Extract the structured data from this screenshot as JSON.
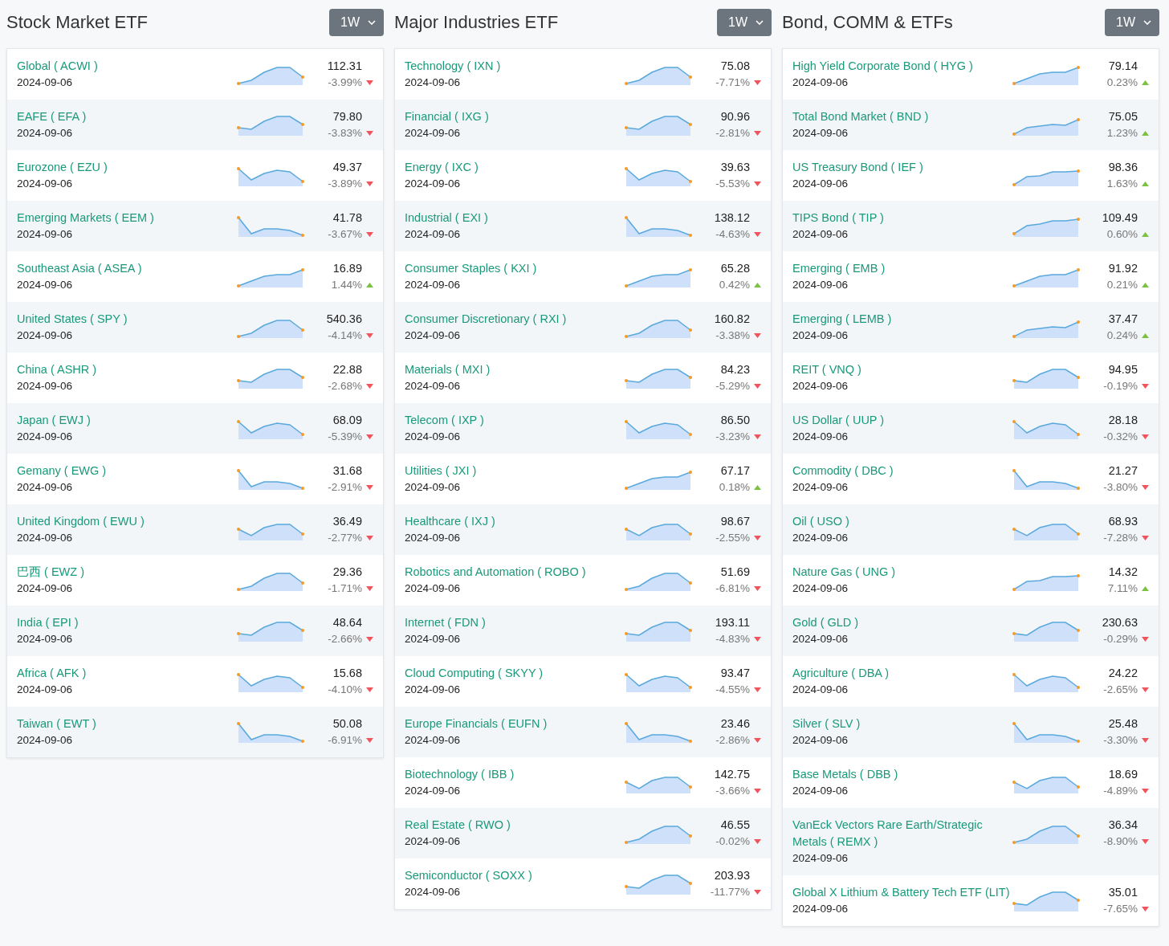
{
  "panels": [
    {
      "title": "Stock Market ETF",
      "period": "1W",
      "rows": [
        {
          "name": "Global ( ACWI )",
          "date": "2024-09-06",
          "price": "112.31",
          "change": "-3.99%",
          "kind": "down"
        },
        {
          "name": "EAFE ( EFA )",
          "date": "2024-09-06",
          "price": "79.80",
          "change": "-3.83%",
          "kind": "down"
        },
        {
          "name": "Eurozone ( EZU )",
          "date": "2024-09-06",
          "price": "49.37",
          "change": "-3.89%",
          "kind": "down"
        },
        {
          "name": "Emerging Markets ( EEM )",
          "date": "2024-09-06",
          "price": "41.78",
          "change": "-3.67%",
          "kind": "down"
        },
        {
          "name": "Southeast Asia ( ASEA )",
          "date": "2024-09-06",
          "price": "16.89",
          "change": "1.44%",
          "kind": "up"
        },
        {
          "name": "United States ( SPY )",
          "date": "2024-09-06",
          "price": "540.36",
          "change": "-4.14%",
          "kind": "down"
        },
        {
          "name": "China ( ASHR )",
          "date": "2024-09-06",
          "price": "22.88",
          "change": "-2.68%",
          "kind": "down"
        },
        {
          "name": "Japan ( EWJ )",
          "date": "2024-09-06",
          "price": "68.09",
          "change": "-5.39%",
          "kind": "down"
        },
        {
          "name": "Gemany ( EWG )",
          "date": "2024-09-06",
          "price": "31.68",
          "change": "-2.91%",
          "kind": "down"
        },
        {
          "name": "United Kingdom ( EWU )",
          "date": "2024-09-06",
          "price": "36.49",
          "change": "-2.77%",
          "kind": "down"
        },
        {
          "name": "巴西 ( EWZ )",
          "date": "2024-09-06",
          "price": "29.36",
          "change": "-1.71%",
          "kind": "down"
        },
        {
          "name": "India ( EPI )",
          "date": "2024-09-06",
          "price": "48.64",
          "change": "-2.66%",
          "kind": "down"
        },
        {
          "name": "Africa ( AFK )",
          "date": "2024-09-06",
          "price": "15.68",
          "change": "-4.10%",
          "kind": "down"
        },
        {
          "name": "Taiwan ( EWT )",
          "date": "2024-09-06",
          "price": "50.08",
          "change": "-6.91%",
          "kind": "down"
        }
      ]
    },
    {
      "title": "Major Industries ETF",
      "period": "1W",
      "rows": [
        {
          "name": "Technology ( IXN )",
          "date": "2024-09-06",
          "price": "75.08",
          "change": "-7.71%",
          "kind": "down"
        },
        {
          "name": "Financial ( IXG )",
          "date": "2024-09-06",
          "price": "90.96",
          "change": "-2.81%",
          "kind": "down"
        },
        {
          "name": "Energy ( IXC )",
          "date": "2024-09-06",
          "price": "39.63",
          "change": "-5.53%",
          "kind": "down"
        },
        {
          "name": "Industrial ( EXI )",
          "date": "2024-09-06",
          "price": "138.12",
          "change": "-4.63%",
          "kind": "down"
        },
        {
          "name": "Consumer Staples ( KXI )",
          "date": "2024-09-06",
          "price": "65.28",
          "change": "0.42%",
          "kind": "up"
        },
        {
          "name": "Consumer Discretionary ( RXI )",
          "date": "2024-09-06",
          "price": "160.82",
          "change": "-3.38%",
          "kind": "down"
        },
        {
          "name": "Materials ( MXI )",
          "date": "2024-09-06",
          "price": "84.23",
          "change": "-5.29%",
          "kind": "down"
        },
        {
          "name": "Telecom ( IXP )",
          "date": "2024-09-06",
          "price": "86.50",
          "change": "-3.23%",
          "kind": "down"
        },
        {
          "name": "Utilities ( JXI )",
          "date": "2024-09-06",
          "price": "67.17",
          "change": "0.18%",
          "kind": "up"
        },
        {
          "name": "Healthcare ( IXJ )",
          "date": "2024-09-06",
          "price": "98.67",
          "change": "-2.55%",
          "kind": "down"
        },
        {
          "name": "Robotics and Automation ( ROBO )",
          "date": "2024-09-06",
          "price": "51.69",
          "change": "-6.81%",
          "kind": "down"
        },
        {
          "name": "Internet ( FDN )",
          "date": "2024-09-06",
          "price": "193.11",
          "change": "-4.83%",
          "kind": "down"
        },
        {
          "name": "Cloud Computing ( SKYY )",
          "date": "2024-09-06",
          "price": "93.47",
          "change": "-4.55%",
          "kind": "down"
        },
        {
          "name": "Europe Financials ( EUFN )",
          "date": "2024-09-06",
          "price": "23.46",
          "change": "-2.86%",
          "kind": "down"
        },
        {
          "name": "Biotechnology ( IBB )",
          "date": "2024-09-06",
          "price": "142.75",
          "change": "-3.66%",
          "kind": "down"
        },
        {
          "name": "Real Estate ( RWO )",
          "date": "2024-09-06",
          "price": "46.55",
          "change": "-0.02%",
          "kind": "down"
        },
        {
          "name": "Semiconductor ( SOXX )",
          "date": "2024-09-06",
          "price": "203.93",
          "change": "-11.77%",
          "kind": "down"
        }
      ]
    },
    {
      "title": "Bond, COMM & ETFs",
      "period": "1W",
      "rows": [
        {
          "name": "High Yield Corporate Bond ( HYG )",
          "date": "2024-09-06",
          "price": "79.14",
          "change": "0.23%",
          "kind": "up"
        },
        {
          "name": "Total Bond Market ( BND )",
          "date": "2024-09-06",
          "price": "75.05",
          "change": "1.23%",
          "kind": "up"
        },
        {
          "name": "US Treasury Bond ( IEF )",
          "date": "2024-09-06",
          "price": "98.36",
          "change": "1.63%",
          "kind": "up"
        },
        {
          "name": "TIPS Bond ( TIP )",
          "date": "2024-09-06",
          "price": "109.49",
          "change": "0.60%",
          "kind": "up"
        },
        {
          "name": "Emerging ( EMB )",
          "date": "2024-09-06",
          "price": "91.92",
          "change": "0.21%",
          "kind": "up"
        },
        {
          "name": "Emerging ( LEMB )",
          "date": "2024-09-06",
          "price": "37.47",
          "change": "0.24%",
          "kind": "up"
        },
        {
          "name": "REIT ( VNQ )",
          "date": "2024-09-06",
          "price": "94.95",
          "change": "-0.19%",
          "kind": "down"
        },
        {
          "name": "US Dollar ( UUP )",
          "date": "2024-09-06",
          "price": "28.18",
          "change": "-0.32%",
          "kind": "down"
        },
        {
          "name": "Commodity ( DBC )",
          "date": "2024-09-06",
          "price": "21.27",
          "change": "-3.80%",
          "kind": "down"
        },
        {
          "name": "Oil ( USO )",
          "date": "2024-09-06",
          "price": "68.93",
          "change": "-7.28%",
          "kind": "down"
        },
        {
          "name": "Nature Gas ( UNG )",
          "date": "2024-09-06",
          "price": "14.32",
          "change": "7.11%",
          "kind": "up"
        },
        {
          "name": "Gold ( GLD )",
          "date": "2024-09-06",
          "price": "230.63",
          "change": "-0.29%",
          "kind": "down"
        },
        {
          "name": "Agriculture ( DBA )",
          "date": "2024-09-06",
          "price": "24.22",
          "change": "-2.65%",
          "kind": "down"
        },
        {
          "name": "Silver ( SLV )",
          "date": "2024-09-06",
          "price": "25.48",
          "change": "-3.30%",
          "kind": "down"
        },
        {
          "name": "Base Metals ( DBB )",
          "date": "2024-09-06",
          "price": "18.69",
          "change": "-4.89%",
          "kind": "down"
        },
        {
          "name": "VanEck Vectors Rare Earth/Strategic Metals ( REMX )",
          "date": "2024-09-06",
          "price": "36.34",
          "change": "-8.90%",
          "kind": "down"
        },
        {
          "name": "Global X Lithium & Battery Tech ETF (LIT)",
          "date": "2024-09-06",
          "price": "35.01",
          "change": "-7.65%",
          "kind": "down"
        }
      ]
    }
  ]
}
